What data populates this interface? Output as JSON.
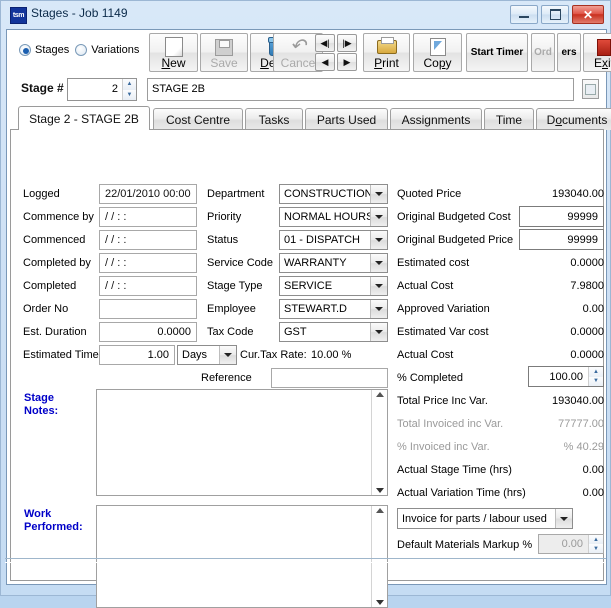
{
  "window": {
    "title": "Stages - Job 1149",
    "icon_label": "tsm",
    "buttons": {
      "minimize": "minimize-button",
      "maximize": "maximize-button",
      "close": "close-button"
    }
  },
  "toolbar": {
    "radios": [
      {
        "label": "Stages",
        "selected": true
      },
      {
        "label": "Variations",
        "selected": false
      }
    ],
    "buttons": [
      {
        "label": "New",
        "accel": "N",
        "icon": "new-document-icon",
        "disabled": false
      },
      {
        "label": "Save",
        "accel": "S",
        "icon": "save-disk-icon",
        "disabled": true
      },
      {
        "label": "Delete",
        "accel": "D",
        "icon": "delete-bin-icon",
        "disabled": false
      },
      {
        "label": "Cance",
        "accel": "C",
        "icon": "undo-arrow-icon",
        "disabled": true
      },
      {
        "label": "Print",
        "accel": "P",
        "icon": "printer-icon",
        "disabled": false
      },
      {
        "label": "Copy",
        "accel": "p",
        "icon": "copy-page-icon",
        "disabled": false
      },
      {
        "label": "Start Timer",
        "accel": "",
        "icon": "",
        "disabled": false
      },
      {
        "label": "Ord",
        "accel": "",
        "icon": "",
        "disabled": true
      },
      {
        "label": "ers",
        "accel": "",
        "icon": "",
        "disabled": false
      },
      {
        "label": "Exit",
        "accel": "x",
        "icon": "exit-door-icon",
        "disabled": false
      }
    ],
    "nav": {
      "first": "first-record-button",
      "last": "last-record-button",
      "prev": "previous-record-button",
      "next": "next-record-button"
    }
  },
  "stage_row": {
    "label": "Stage #",
    "number": "2",
    "name": "STAGE 2B",
    "lookup_button": "lookup-button"
  },
  "tabs": [
    {
      "label": "Stage 2 - STAGE 2B",
      "active": true
    },
    {
      "label": "Cost Centre",
      "active": false
    },
    {
      "label": "Tasks",
      "active": false
    },
    {
      "label": "Parts Used",
      "active": false
    },
    {
      "label": "Assignments",
      "active": false
    },
    {
      "label": "Time",
      "active": false
    },
    {
      "label": "Documents",
      "active": false
    }
  ],
  "form": {
    "col1": [
      {
        "label": "Logged",
        "value": "22/01/2010 00:00",
        "align": "left"
      },
      {
        "label": "Commence by",
        "value": "/ /      : :",
        "align": "left"
      },
      {
        "label": "Commenced",
        "value": "/ /      : :",
        "align": "left"
      },
      {
        "label": "Completed by",
        "value": "/ /      : :",
        "align": "left"
      },
      {
        "label": "Completed",
        "value": "/ /      : :",
        "align": "left"
      },
      {
        "label": "Order No",
        "value": "",
        "align": "left"
      },
      {
        "label": "Est. Duration",
        "value": "0.0000",
        "align": "right"
      }
    ],
    "estimated_time": {
      "label": "Estimated Time",
      "value": "1.00",
      "unit": "Days"
    },
    "col2": [
      {
        "label": "Department",
        "value": "CONSTRUCTION"
      },
      {
        "label": "Priority",
        "value": "NORMAL HOURS"
      },
      {
        "label": "Status",
        "value": "01 - DISPATCH"
      },
      {
        "label": "Service Code",
        "value": "WARRANTY"
      },
      {
        "label": "Stage Type",
        "value": "SERVICE"
      },
      {
        "label": "Employee",
        "value": "STEWART.D"
      },
      {
        "label": "Tax Code",
        "value": "GST"
      }
    ],
    "tax_rate": {
      "label": "Cur.Tax Rate:",
      "value": "10.00 %"
    },
    "reference": {
      "label": "Reference",
      "value": ""
    },
    "stage_notes": {
      "label_line1": "Stage",
      "label_line2": "Notes:",
      "value": ""
    },
    "work_performed": {
      "label_line1": "Work",
      "label_line2": "Performed:",
      "value": ""
    }
  },
  "financials": {
    "rows": [
      {
        "label": "Quoted Price",
        "value": "193040.00",
        "kind": "text",
        "muted": false
      },
      {
        "label": "Original Budgeted Cost",
        "value": "99999",
        "kind": "input",
        "muted": false
      },
      {
        "label": "Original Budgeted Price",
        "value": "99999",
        "kind": "input",
        "muted": false
      },
      {
        "label": "Estimated cost",
        "value": "0.0000",
        "kind": "text",
        "muted": false
      },
      {
        "label": "Actual Cost",
        "value": "7.9800",
        "kind": "text",
        "muted": false
      },
      {
        "label": "Approved Variation",
        "value": "0.00",
        "kind": "text",
        "muted": false
      },
      {
        "label": "Estimated Var cost",
        "value": "0.0000",
        "kind": "text",
        "muted": false
      },
      {
        "label": "Actual Cost",
        "value": "0.0000",
        "kind": "text",
        "muted": false
      },
      {
        "label": "% Completed",
        "value": "100.00",
        "kind": "spin",
        "muted": false
      },
      {
        "label": "Total Price Inc Var.",
        "value": "193040.00",
        "kind": "text",
        "muted": false
      },
      {
        "label": "Total Invoiced inc Var.",
        "value": "77777.00",
        "kind": "text",
        "muted": true
      },
      {
        "label": "% Invoiced inc Var.",
        "value": "% 40.29",
        "kind": "text",
        "muted": true
      },
      {
        "label": "Actual Stage Time (hrs)",
        "value": "0.00",
        "kind": "text",
        "muted": false
      },
      {
        "label": "Actual Variation Time (hrs)",
        "value": "0.00",
        "kind": "text",
        "muted": false
      }
    ],
    "invoice_type": "Invoice for parts / labour used",
    "markup": {
      "label": "Default Materials Markup %",
      "value": "0.00",
      "disabled": true
    }
  },
  "colors": {
    "window_frame": "#b9d4ef",
    "accent_blue": "#0000c8",
    "close_red": "#c9301f",
    "muted_text": "#9a9a9a"
  }
}
